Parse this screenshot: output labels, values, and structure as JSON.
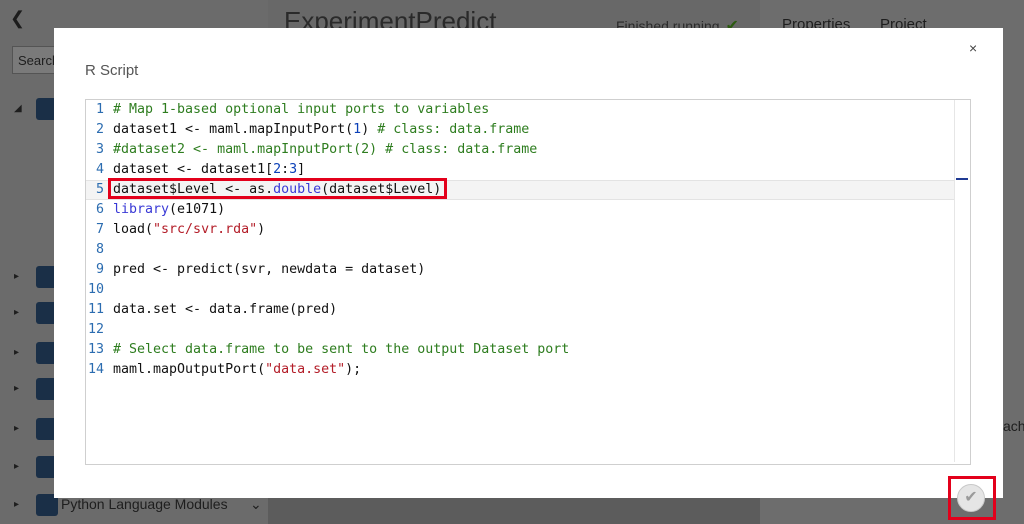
{
  "background": {
    "experiment_title": "ExperimentPredict",
    "status_text": "Finished running",
    "status_icon": "check-icon",
    "tabs": [
      "Properties",
      "Project"
    ],
    "search_label": "Search",
    "python_modules_label": "Python Language Modules",
    "right_partial_text": "ach"
  },
  "modal": {
    "title": "R Script",
    "close_label": "×",
    "ok_icon": "check-icon",
    "highlight_color": "#e3001b",
    "code_lines": [
      {
        "num": "1",
        "text": "# Map 1-based optional input ports to variables"
      },
      {
        "num": "2",
        "text": "dataset1 <- maml.mapInputPort(1) # class: data.frame"
      },
      {
        "num": "3",
        "text": "#dataset2 <- maml.mapInputPort(2) # class: data.frame"
      },
      {
        "num": "4",
        "text": "dataset <- dataset1[2:3]"
      },
      {
        "num": "5",
        "text": "dataset$Level <- as.double(dataset$Level)"
      },
      {
        "num": "6",
        "text": "library(e1071)"
      },
      {
        "num": "7",
        "text": "load(\"src/svr.rda\")"
      },
      {
        "num": "8",
        "text": ""
      },
      {
        "num": "9",
        "text": "pred <- predict(svr, newdata = dataset)"
      },
      {
        "num": "10",
        "text": ""
      },
      {
        "num": "11",
        "text": "data.set <- data.frame(pred)"
      },
      {
        "num": "12",
        "text": ""
      },
      {
        "num": "13",
        "text": "# Select data.frame to be sent to the output Dataset port"
      },
      {
        "num": "14",
        "text": "maml.mapOutputPort(\"data.set\");"
      }
    ]
  }
}
